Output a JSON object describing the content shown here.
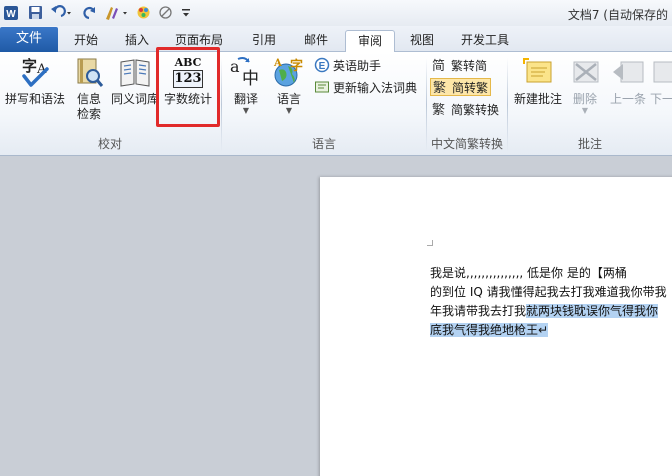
{
  "window": {
    "title": "文档7 (自动保存的"
  },
  "tabs": [
    {
      "label": "文件"
    },
    {
      "label": "开始"
    },
    {
      "label": "插入"
    },
    {
      "label": "页面布局"
    },
    {
      "label": "引用"
    },
    {
      "label": "邮件"
    },
    {
      "label": "审阅"
    },
    {
      "label": "视图"
    },
    {
      "label": "开发工具"
    }
  ],
  "active_tab": "审阅",
  "ribbon": {
    "proofing": {
      "group_label": "校对",
      "spelling": "拼写和语法",
      "research_1": "信息",
      "research_2": "检索",
      "thesaurus": "同义词库",
      "word_count": "字数统计",
      "word_count_icon_text": [
        "ABC",
        "123"
      ]
    },
    "language": {
      "group_label": "语言",
      "translate": "翻译",
      "language": "语言",
      "english_assistant": "英语助手",
      "update_ime": "更新输入法词典"
    },
    "chinese_conversion": {
      "group_label": "中文简繁转换",
      "to_simplified": "繁转简",
      "to_traditional": "简转繁",
      "convert": "简繁转换"
    },
    "comments": {
      "group_label": "批注",
      "new_comment": "新建批注",
      "delete": "删除",
      "previous": "上一条",
      "next": "下一"
    }
  },
  "document": {
    "lines": [
      {
        "plain": "我是说,,,,,,,,,,,,,,, 低是你 是的【两桶",
        "selected": ""
      },
      {
        "plain": "的到位 IQ 请我懂得起我去打我难道我你带我",
        "selected": ""
      },
      {
        "plain": "年我请带我去打我",
        "selected": "就两块钱耽误你气得我你"
      },
      {
        "plain": "",
        "selected": "底我气得我绝地枪王↵"
      }
    ]
  },
  "colors": {
    "file_tab": "#2b67b5",
    "highlight_box": "#e12a2a",
    "selection": "#b3d2f2"
  }
}
